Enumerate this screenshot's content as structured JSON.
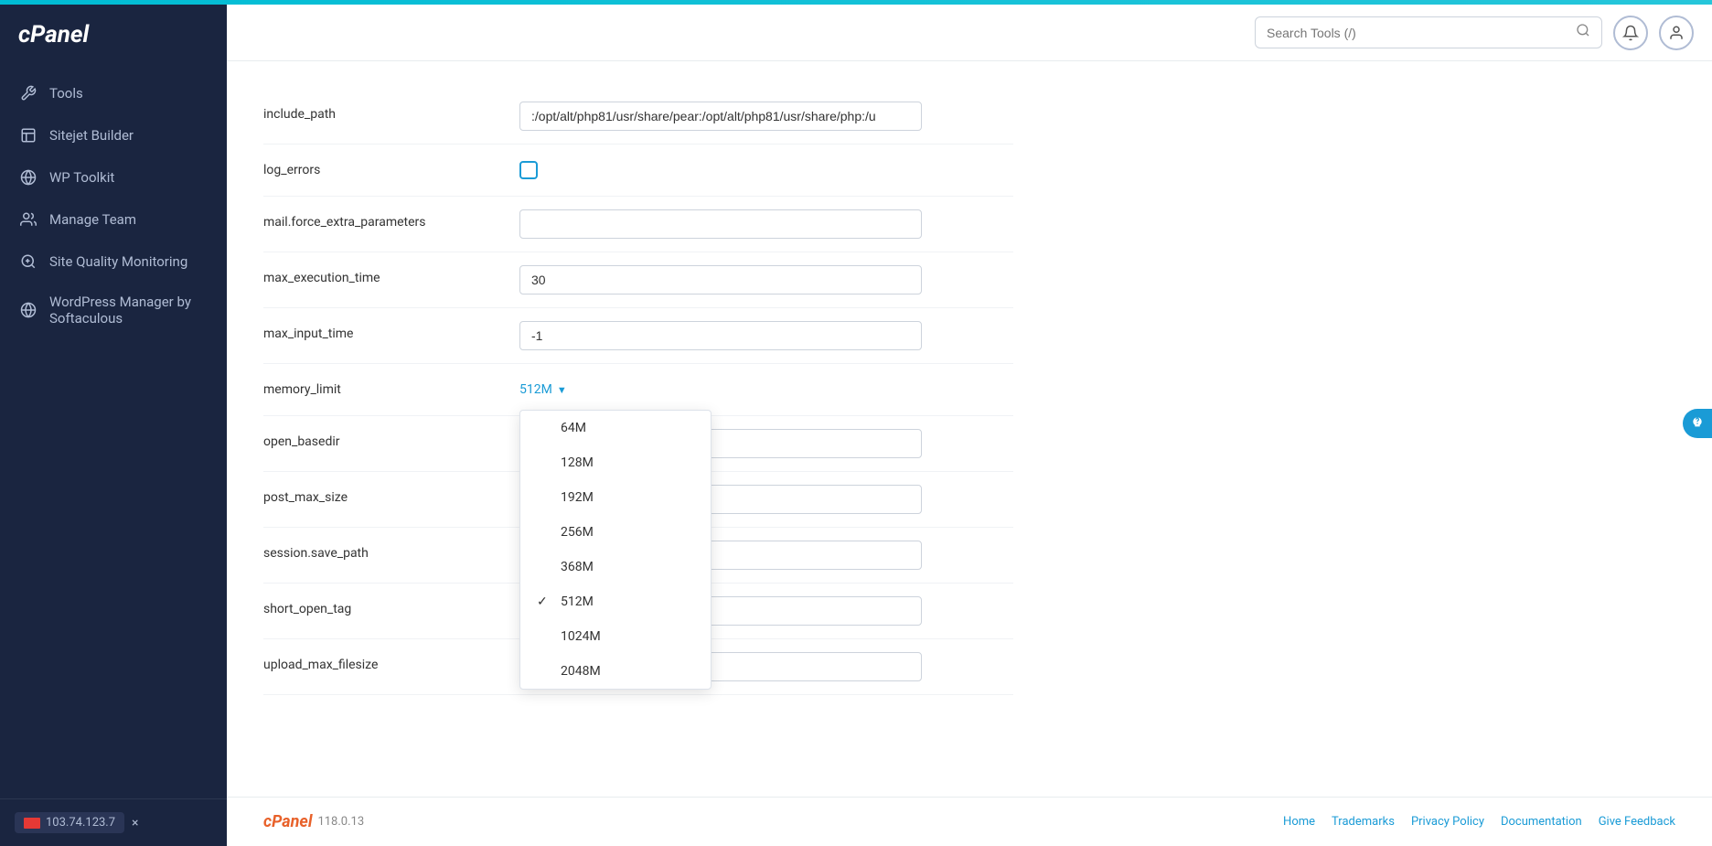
{
  "topbar": {},
  "sidebar": {
    "logo": "cPanel",
    "nav_items": [
      {
        "id": "tools",
        "label": "Tools",
        "icon": "wrench"
      },
      {
        "id": "sitejet",
        "label": "Sitejet Builder",
        "icon": "sitejet"
      },
      {
        "id": "wp-toolkit",
        "label": "WP Toolkit",
        "icon": "wordpress"
      },
      {
        "id": "manage-team",
        "label": "Manage Team",
        "icon": "team"
      },
      {
        "id": "site-quality",
        "label": "Site Quality Monitoring",
        "icon": "search-quality"
      },
      {
        "id": "wp-manager",
        "label": "WordPress Manager by Softaculous",
        "icon": "wordpress2"
      }
    ],
    "footer_ip": "103.74.123.7",
    "close_label": "×"
  },
  "header": {
    "search_placeholder": "Search Tools (/)"
  },
  "form": {
    "rows": [
      {
        "id": "include_path",
        "label": "include_path",
        "type": "text",
        "value": ":/opt/alt/php81/usr/share/pear:/opt/alt/php81/usr/share/php:/u"
      },
      {
        "id": "log_errors",
        "label": "log_errors",
        "type": "checkbox",
        "value": false
      },
      {
        "id": "mail_force_extra_parameters",
        "label": "mail.force_extra_parameters",
        "type": "text",
        "value": ""
      },
      {
        "id": "max_execution_time",
        "label": "max_execution_time",
        "type": "text",
        "value": "30"
      },
      {
        "id": "max_input_time",
        "label": "max_input_time",
        "type": "text",
        "value": "-1"
      },
      {
        "id": "memory_limit",
        "label": "memory_limit",
        "type": "dropdown",
        "value": "512M"
      },
      {
        "id": "open_basedir",
        "label": "open_basedir",
        "type": "text",
        "value": ""
      },
      {
        "id": "post_max_size",
        "label": "post_max_size",
        "type": "text",
        "value": ""
      },
      {
        "id": "session_save_path",
        "label": "session.save_path",
        "type": "text",
        "value": ""
      },
      {
        "id": "short_open_tag",
        "label": "short_open_tag",
        "type": "text",
        "value": ""
      },
      {
        "id": "upload_max_filesize",
        "label": "upload_max_filesize",
        "type": "text",
        "value": ""
      }
    ],
    "dropdown_options": [
      {
        "value": "64M",
        "selected": false
      },
      {
        "value": "128M",
        "selected": false
      },
      {
        "value": "192M",
        "selected": false
      },
      {
        "value": "256M",
        "selected": false
      },
      {
        "value": "368M",
        "selected": false
      },
      {
        "value": "512M",
        "selected": true
      },
      {
        "value": "1024M",
        "selected": false
      },
      {
        "value": "2048M",
        "selected": false
      }
    ]
  },
  "footer": {
    "brand": "cPanel",
    "version": "118.0.13",
    "links": [
      {
        "label": "Home",
        "id": "home"
      },
      {
        "label": "Trademarks",
        "id": "trademarks"
      },
      {
        "label": "Privacy Policy",
        "id": "privacy"
      },
      {
        "label": "Documentation",
        "id": "docs"
      },
      {
        "label": "Give Feedback",
        "id": "feedback"
      }
    ]
  }
}
